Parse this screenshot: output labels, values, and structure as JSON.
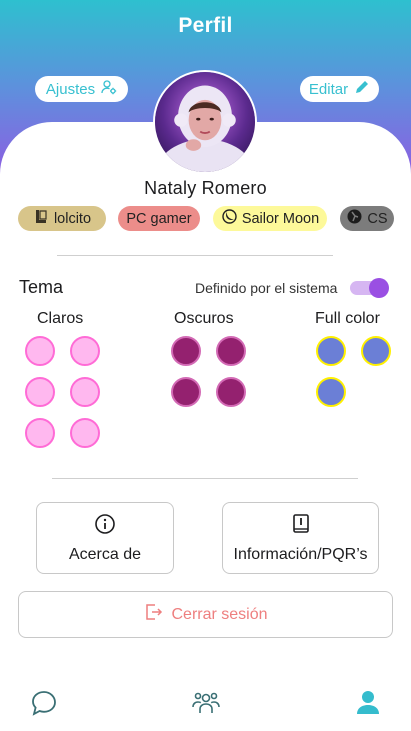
{
  "header": {
    "title": "Perfil",
    "settings_label": "Ajustes",
    "edit_label": "Editar"
  },
  "profile": {
    "name": "Nataly Romero",
    "tags": [
      "lolcito",
      "PC gamer",
      "Sailor Moon",
      "CS"
    ]
  },
  "theme": {
    "title": "Tema",
    "system_label": "Definido por el sistema",
    "system_enabled": true,
    "columns": {
      "light": "Claros",
      "dark": "Oscuros",
      "full": "Full color"
    }
  },
  "actions": {
    "about_label": "Acerca de",
    "info_label": "Información/PQR’s",
    "logout_label": "Cerrar sesión"
  },
  "bottom_nav": {
    "items": [
      "chat-icon",
      "groups-icon",
      "profile-icon"
    ],
    "active": "profile-icon"
  },
  "colors": {
    "accent": "#38c0d0",
    "purple": "#9a4fe3",
    "logout": "#ee7f7f"
  }
}
